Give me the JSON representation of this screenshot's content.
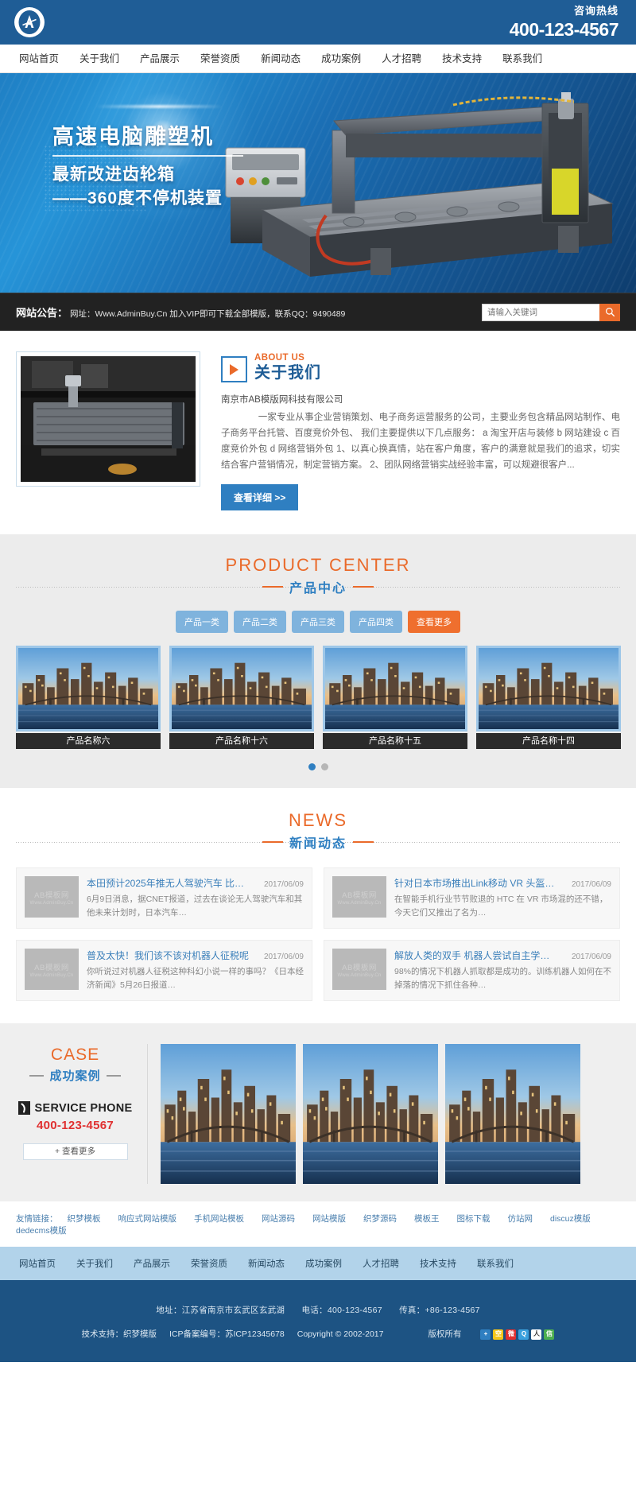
{
  "header": {
    "logo_letter": "A",
    "hotline_label": "咨询热线",
    "hotline_number": "400-123-4567"
  },
  "nav": {
    "items": [
      {
        "label": "网站首页"
      },
      {
        "label": "关于我们"
      },
      {
        "label": "产品展示"
      },
      {
        "label": "荣誉资质"
      },
      {
        "label": "新闻动态"
      },
      {
        "label": "成功案例"
      },
      {
        "label": "人才招聘"
      },
      {
        "label": "技术支持"
      },
      {
        "label": "联系我们"
      }
    ]
  },
  "hero": {
    "line1": "高速电脑雕塑机",
    "line2": "最新改进齿轮箱",
    "line3": "——360度不停机装置"
  },
  "notice": {
    "title": "网站公告：",
    "text": "网址：Www.AdminBuy.Cn 加入VIP即可下载全部模版，联系QQ：9490489",
    "search_placeholder": "请输入关键词",
    "search_value": "",
    "search_icon": "search-icon"
  },
  "about": {
    "en_title": "ABOUT US",
    "cn_title": "关于我们",
    "company": "南京市AB模版网科技有限公司",
    "text": "　　　　一家专业从事企业营销策划、电子商务运营服务的公司，主要业务包含精品网站制作、电子商务平台托管、百度竞价外包、 我们主要提供以下几点服务： a 淘宝开店与装修 b 网站建设 c 百度竞价外包 d 网络营销外包 1、以真心换真情，站在客户角度，客户的满意就是我们的追求，切实结合客户营销情况，制定营销方案。 2、团队网络营销实战经验丰富，可以规避很客户...",
    "button": "查看详细 >>"
  },
  "products": {
    "en_title": "PRODUCT CENTER",
    "cn_title": "产品中心",
    "tabs": [
      {
        "label": "产品一类",
        "highlight": false
      },
      {
        "label": "产品二类",
        "highlight": false
      },
      {
        "label": "产品三类",
        "highlight": false
      },
      {
        "label": "产品四类",
        "highlight": false
      },
      {
        "label": "查看更多",
        "highlight": true
      }
    ],
    "items": [
      {
        "name": "产品名称六"
      },
      {
        "name": "产品名称十六"
      },
      {
        "name": "产品名称十五"
      },
      {
        "name": "产品名称十四"
      }
    ],
    "pager": {
      "active_index": 0,
      "count": 2
    }
  },
  "news": {
    "en_title": "NEWS",
    "cn_title": "新闻动态",
    "thumb_line1": "AB模板网",
    "thumb_line2": "Www.AdminBuy.Cn",
    "items": [
      {
        "title": "本田预计2025年推无人驾驶汽车 比…",
        "date": "2017/06/09",
        "desc": "6月9日消息，据CNET报道，过去在谈论无人驾驶汽车和其他未来计划时，日本汽车…"
      },
      {
        "title": "针对日本市场推出Link移动 VR 头盔…",
        "date": "2017/06/09",
        "desc": "在智能手机行业节节败退的 HTC 在 VR 市场混的还不错，今天它们又推出了名为…"
      },
      {
        "title": "普及太快！我们该不该对机器人征税呢",
        "date": "2017/06/09",
        "desc": "你听说过对机器人征税这种科幻小说一样的事吗？《日本经济新闻》5月26日报道…"
      },
      {
        "title": "解放人类的双手 机器人尝试自主学…",
        "date": "2017/06/09",
        "desc": "98%的情况下机器人抓取都是成功的。训练机器人如何在不掉落的情况下抓住各种…"
      }
    ]
  },
  "cases": {
    "en_title": "CASE",
    "cn_title": "成功案例",
    "phone_label": "SERVICE PHONE",
    "phone_icon": "phone-icon",
    "phone_number": "400-123-4567",
    "more_button": "+ 查看更多",
    "thumbs": 3
  },
  "links": {
    "label": "友情链接：",
    "items": [
      {
        "label": "织梦模板"
      },
      {
        "label": "响应式网站模版"
      },
      {
        "label": "手机网站模板"
      },
      {
        "label": "网站源码"
      },
      {
        "label": "网站模版"
      },
      {
        "label": "织梦源码"
      },
      {
        "label": "模板王"
      },
      {
        "label": "图标下载"
      },
      {
        "label": "仿站网"
      },
      {
        "label": "discuz模版"
      },
      {
        "label": "dedecms模版"
      }
    ]
  },
  "footnav": {
    "items": [
      {
        "label": "网站首页"
      },
      {
        "label": "关于我们"
      },
      {
        "label": "产品展示"
      },
      {
        "label": "荣誉资质"
      },
      {
        "label": "新闻动态"
      },
      {
        "label": "成功案例"
      },
      {
        "label": "人才招聘"
      },
      {
        "label": "技术支持"
      },
      {
        "label": "联系我们"
      }
    ]
  },
  "footer": {
    "address": "地址：江苏省南京市玄武区玄武湖",
    "phone": "电话：400-123-4567",
    "fax": "传真：+86-123-4567",
    "support": "技术支持：织梦模版",
    "icp": "ICP备案编号：苏ICP12345678",
    "copyright": "Copyright © 2002-2017",
    "rights": "版权所有",
    "social_icons": [
      {
        "name": "baidu-share-icon",
        "glyph": "+",
        "color": "#2f7fc1"
      },
      {
        "name": "qzone-icon",
        "glyph": "空",
        "color": "#f5c518"
      },
      {
        "name": "sina-weibo-icon",
        "glyph": "微",
        "color": "#e03030"
      },
      {
        "name": "tencent-weibo-icon",
        "glyph": "Q",
        "color": "#3aa0dd"
      },
      {
        "name": "renren-icon",
        "glyph": "人",
        "color": "#ffffff"
      },
      {
        "name": "wechat-icon",
        "glyph": "信",
        "color": "#4caf50"
      }
    ]
  },
  "colors": {
    "brand_blue": "#1f5d96",
    "accent_orange": "#ea6a2a",
    "link_blue": "#3a7fba",
    "footer_blue": "#1d5383"
  }
}
